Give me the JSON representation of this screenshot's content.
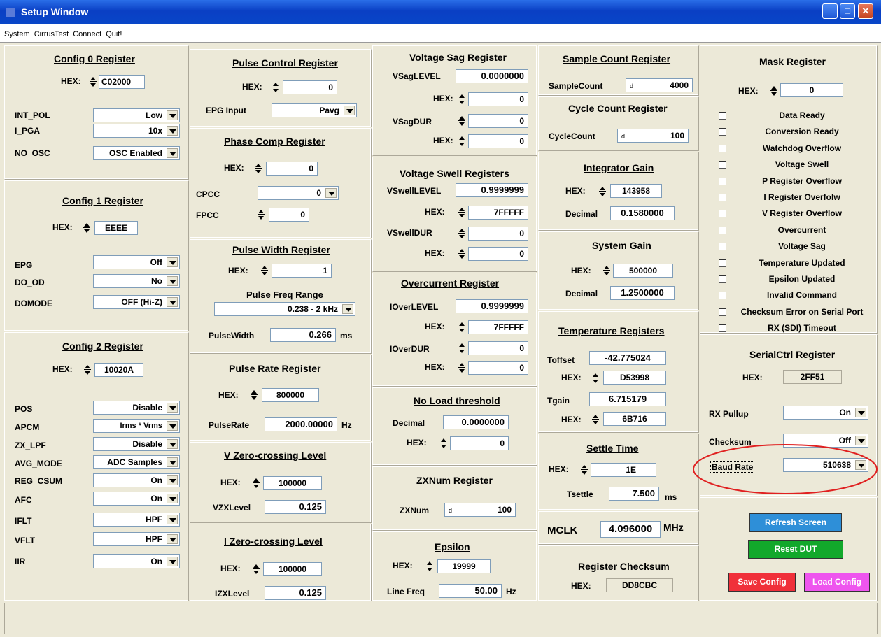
{
  "window": {
    "title": "Setup Window"
  },
  "menu": [
    "System",
    "CirrusTest",
    "Connect",
    "Quit!"
  ],
  "config0": {
    "title": "Config 0 Register",
    "hex_label": "HEX:",
    "hex": "C02000",
    "rows": [
      {
        "label": "INT_POL",
        "value": "Low"
      },
      {
        "label": "I_PGA",
        "value": "10x"
      },
      {
        "label": "NO_OSC",
        "value": "OSC Enabled"
      }
    ]
  },
  "config1": {
    "title": "Config 1 Register",
    "hex_label": "HEX:",
    "hex": "EEEE",
    "rows": [
      {
        "label": "EPG",
        "value": "Off"
      },
      {
        "label": "DO_OD",
        "value": "No"
      },
      {
        "label": "DOMODE",
        "value": "OFF (Hi-Z)"
      }
    ]
  },
  "config2": {
    "title": "Config 2 Register",
    "hex_label": "HEX:",
    "hex": "10020A",
    "rows": [
      {
        "label": "POS",
        "value": "Disable"
      },
      {
        "label": "APCM",
        "value": "Irms * Vrms"
      },
      {
        "label": "ZX_LPF",
        "value": "Disable"
      },
      {
        "label": "AVG_MODE",
        "value": "ADC Samples"
      },
      {
        "label": "REG_CSUM",
        "value": "On"
      },
      {
        "label": "AFC",
        "value": "On"
      },
      {
        "label": "IFLT",
        "value": "HPF"
      },
      {
        "label": "VFLT",
        "value": "HPF"
      },
      {
        "label": "IIR",
        "value": "On"
      }
    ]
  },
  "pulse_control": {
    "title": "Pulse Control Register",
    "hex_label": "HEX:",
    "hex": "0",
    "epg_label": "EPG Input",
    "epg_value": "Pavg"
  },
  "phase_comp": {
    "title": "Phase Comp Register",
    "hex_label": "HEX:",
    "hex": "0",
    "cpcc_label": "CPCC",
    "cpcc_value": "0",
    "fpcc_label": "FPCC",
    "fpcc_value": "0"
  },
  "pulse_width": {
    "title": "Pulse Width Register",
    "hex_label": "HEX:",
    "hex": "1",
    "range_label": "Pulse Freq Range",
    "range_value": "0.238 - 2 kHz",
    "pw_label": "PulseWidth",
    "pw_value": "0.266",
    "pw_unit": "ms"
  },
  "pulse_rate": {
    "title": "Pulse Rate Register",
    "hex_label": "HEX:",
    "hex": "800000",
    "rate_label": "PulseRate",
    "rate_value": "2000.00000",
    "rate_unit": "Hz"
  },
  "vzero": {
    "title": "V Zero-crossing Level",
    "hex_label": "HEX:",
    "hex": "100000",
    "lvl_label": "VZXLevel",
    "lvl_value": "0.125"
  },
  "izero": {
    "title": "I Zero-crossing Level",
    "hex_label": "HEX:",
    "hex": "100000",
    "lvl_label": "IZXLevel",
    "lvl_value": "0.125"
  },
  "vsag": {
    "title": "Voltage Sag Register",
    "level_label": "VSagLEVEL",
    "level_value": "0.0000000",
    "hex_label": "HEX:",
    "hex1": "0",
    "dur_label": "VSagDUR",
    "dur_value": "0",
    "hex2": "0"
  },
  "vswell": {
    "title": "Voltage Swell Registers",
    "level_label": "VSwellLEVEL",
    "level_value": "0.9999999",
    "hex_label": "HEX:",
    "hex1": "7FFFFF",
    "dur_label": "VSwellDUR",
    "dur_value": "0",
    "hex2": "0"
  },
  "overcurrent": {
    "title": "Overcurrent Register",
    "level_label": "IOverLEVEL",
    "level_value": "0.9999999",
    "hex_label": "HEX:",
    "hex1": "7FFFFF",
    "dur_label": "IOverDUR",
    "dur_value": "0",
    "hex2": "0"
  },
  "noload": {
    "title": "No Load threshold",
    "dec_label": "Decimal",
    "dec_value": "0.0000000",
    "hex_label": "HEX:",
    "hex": "0"
  },
  "zxnum": {
    "title": "ZXNum Register",
    "label": "ZXNum",
    "value": "100"
  },
  "epsilon": {
    "title": "Epsilon",
    "hex_label": "HEX:",
    "hex": "19999",
    "lf_label": "Line Freq",
    "lf_value": "50.00",
    "lf_unit": "Hz"
  },
  "sample_count": {
    "title": "Sample Count Register",
    "label": "SampleCount",
    "value": "4000"
  },
  "cycle_count": {
    "title": "Cycle Count Register",
    "label": "CycleCount",
    "value": "100"
  },
  "integrator": {
    "title": "Integrator Gain",
    "hex_label": "HEX:",
    "hex": "143958",
    "dec_label": "Decimal",
    "dec_value": "0.1580000"
  },
  "system_gain": {
    "title": "System Gain",
    "hex_label": "HEX:",
    "hex": "500000",
    "dec_label": "Decimal",
    "dec_value": "1.2500000"
  },
  "temperature": {
    "title": "Temperature Registers",
    "toffset_label": "Toffset",
    "toffset_value": "-42.775024",
    "hex_label": "HEX:",
    "hex1": "D53998",
    "tgain_label": "Tgain",
    "tgain_value": "6.715179",
    "hex2": "6B716"
  },
  "settle": {
    "title": "Settle Time",
    "hex_label": "HEX:",
    "hex": "1E",
    "ts_label": "Tsettle",
    "ts_value": "7.500",
    "ts_unit": "ms"
  },
  "mclk": {
    "label": "MCLK",
    "value": "4.096000",
    "unit": "MHz"
  },
  "checksum": {
    "title": "Register Checksum",
    "hex_label": "HEX:",
    "hex": "DD8CBC"
  },
  "mask": {
    "title": "Mask Register",
    "hex_label": "HEX:",
    "hex": "0",
    "items": [
      "Data Ready",
      "Conversion Ready",
      "Watchdog Overflow",
      "Voltage Swell",
      "P Register Overflow",
      "I Register Overfolw",
      "V Register Overflow",
      "Overcurrent",
      "Voltage Sag",
      "Temperature Updated",
      "Epsilon Updated",
      "Invalid Command",
      "Checksum Error on Serial Port",
      "RX (SDI) Timeout"
    ]
  },
  "serialctrl": {
    "title": "SerialCtrl Register",
    "hex_label": "HEX:",
    "hex": "2FF51",
    "rx_label": "RX Pullup",
    "rx_value": "On",
    "cs_label": "Checksum",
    "cs_value": "Off",
    "baud_label": "Baud Rate",
    "baud_value": "510638"
  },
  "buttons": {
    "refresh": "Refresh Screen",
    "reset": "Reset DUT",
    "save": "Save Config",
    "load": "Load Config"
  },
  "colors": {
    "refresh": "#2e8fd8",
    "reset": "#12a82b",
    "save": "#f0303a",
    "load": "#ee55ee",
    "highlight": "#e02020"
  }
}
